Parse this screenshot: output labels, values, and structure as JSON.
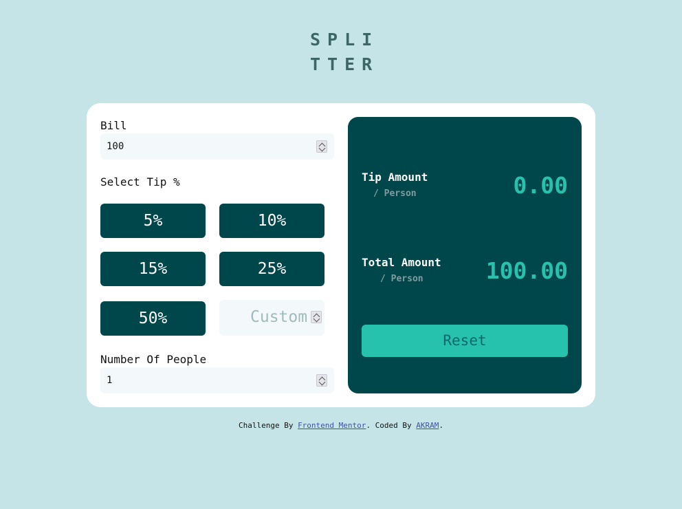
{
  "logo": {
    "line1": "SPLI",
    "line2": "TTER"
  },
  "bill": {
    "label": "Bill",
    "value": "100"
  },
  "tip": {
    "label": "Select Tip %",
    "options": [
      "5%",
      "10%",
      "15%",
      "25%",
      "50%"
    ],
    "custom_placeholder": "Custom"
  },
  "people": {
    "label": "Number Of People",
    "value": "1"
  },
  "results": {
    "tip_title": "Tip Amount",
    "tip_sub": "/ Person",
    "tip_value": "0.00",
    "total_title": "Total Amount",
    "total_sub": "/ Person",
    "total_value": "100.00",
    "reset_label": "Reset"
  },
  "footer": {
    "prefix": "Challenge By ",
    "link1": "Frontend Mentor",
    "middle": ". Coded By ",
    "link2": "AKRAM",
    "suffix": "."
  },
  "colors": {
    "background": "#c5e4e7",
    "dark_cyan": "#00474b",
    "accent": "#26c2ae"
  }
}
